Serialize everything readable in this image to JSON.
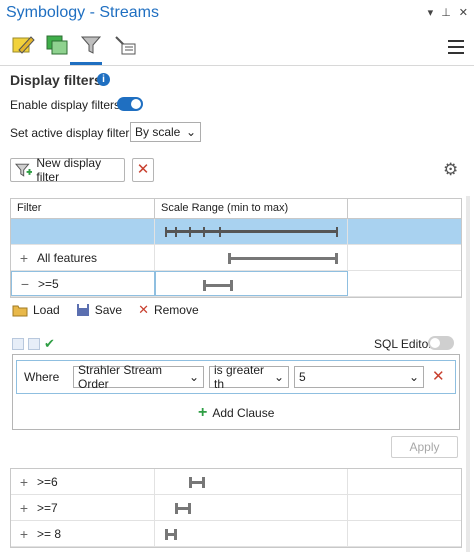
{
  "window": {
    "title": "Symbology - Streams"
  },
  "title_tools": {
    "menu": "▾",
    "pin": "⊥",
    "close": "✕"
  },
  "tabs": [
    {
      "name": "primary-symbology-tab",
      "icon": "pencil-icon"
    },
    {
      "name": "symbol-layers-tab",
      "icon": "layers-icon"
    },
    {
      "name": "display-filters-tab",
      "icon": "filter-icon",
      "active": true
    },
    {
      "name": "vary-by-attribute-tab",
      "icon": "brush-list-icon"
    }
  ],
  "section": {
    "heading": "Display filters",
    "info": "i"
  },
  "enable": {
    "label": "Enable display filters",
    "on": true
  },
  "active_filter": {
    "label": "Set active display filter:",
    "value": "By scale"
  },
  "toolbar": {
    "new_filter_label": "New display filter",
    "delete": "✕"
  },
  "table": {
    "headers": [
      "Filter",
      "Scale Range (min to max)"
    ],
    "rows": [
      {
        "expander": "+",
        "label": "All features",
        "range": [
          0.45,
          0.97
        ]
      },
      {
        "expander": "−",
        "label": ">=5",
        "range": [
          0.28,
          0.43
        ]
      }
    ]
  },
  "actions": {
    "load": "Load",
    "save": "Save",
    "remove": "Remove"
  },
  "sql_editor": {
    "label": "SQL Editor",
    "on": false
  },
  "clause": {
    "where": "Where",
    "field": "Strahler Stream Order",
    "operator": "is greater th",
    "value": "5",
    "clear": "✕"
  },
  "add_clause": {
    "plus": "+",
    "label": "Add Clause"
  },
  "apply": {
    "label": "Apply"
  },
  "more_rows": [
    {
      "expander": "+",
      "label": ">=6"
    },
    {
      "expander": "+",
      "label": ">=7"
    },
    {
      "expander": "+",
      "label": ">= 8"
    }
  ],
  "colors": {
    "accent": "#1f6fc1",
    "selection": "#a9d2f0",
    "danger": "#c8402f",
    "success": "#2f9e44"
  }
}
